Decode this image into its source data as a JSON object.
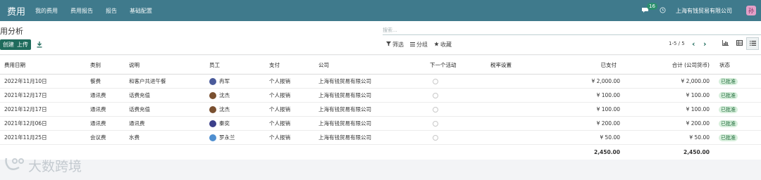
{
  "topbar": {
    "brand": "费用",
    "menu": [
      "我的费用",
      "费用报告",
      "报告",
      "基础配置"
    ],
    "messages_count": "16",
    "company": "上海有钱贸易有限公司",
    "avatar_letter": "孙"
  },
  "control": {
    "title": "用分析",
    "buttons": {
      "create": "创建",
      "upload": "上传"
    },
    "search_placeholder": "搜索...",
    "filter": "筛选",
    "group": "分组",
    "favorite": "收藏",
    "pager": "1-5 / 5"
  },
  "table": {
    "headers": {
      "date": "费用日期",
      "category": "类别",
      "description": "说明",
      "employee": "员工",
      "payment": "支付",
      "company": "公司",
      "next_activity": "下一个活动",
      "tax": "税率设置",
      "paid": "已支付",
      "total": "合计 (公司货币)",
      "status": "状态"
    },
    "rows": [
      {
        "date": "2022年11月10日",
        "category": "餐费",
        "description": "和客户共进午餐",
        "employee": "冉军",
        "payment": "个人报销",
        "company": "上海有钱贸易有限公司",
        "paid": "¥ 2,000.00",
        "total": "¥ 2,000.00",
        "status": "已批准"
      },
      {
        "date": "2021年12月17日",
        "category": "通讯费",
        "description": "话费充值",
        "employee": "沈杰",
        "payment": "个人报销",
        "company": "上海有钱贸易有限公司",
        "paid": "¥ 100.00",
        "total": "¥ 100.00",
        "status": "已批准"
      },
      {
        "date": "2021年12月17日",
        "category": "通讯费",
        "description": "话费充值",
        "employee": "沈杰",
        "payment": "个人报销",
        "company": "上海有钱贸易有限公司",
        "paid": "¥ 100.00",
        "total": "¥ 100.00",
        "status": "已批准"
      },
      {
        "date": "2021年12月06日",
        "category": "通讯费",
        "description": "通讯费",
        "employee": "秦奕",
        "payment": "个人报销",
        "company": "上海有钱贸易有限公司",
        "paid": "¥ 200.00",
        "total": "¥ 200.00",
        "status": "已批准"
      },
      {
        "date": "2021年11月25日",
        "category": "会议费",
        "description": "水费",
        "employee": "罗永兰",
        "payment": "个人报销",
        "company": "上海有钱贸易有限公司",
        "paid": "¥ 50.00",
        "total": "¥ 50.00",
        "status": "已批准"
      }
    ],
    "totals": {
      "paid": "2,450.00",
      "total": "2,450.00"
    }
  },
  "watermark": "大数跨境",
  "colors": {
    "topbar": "#3f7a8c",
    "primary_button": "#1f6b5c",
    "status_badge": "#d7efdc"
  }
}
